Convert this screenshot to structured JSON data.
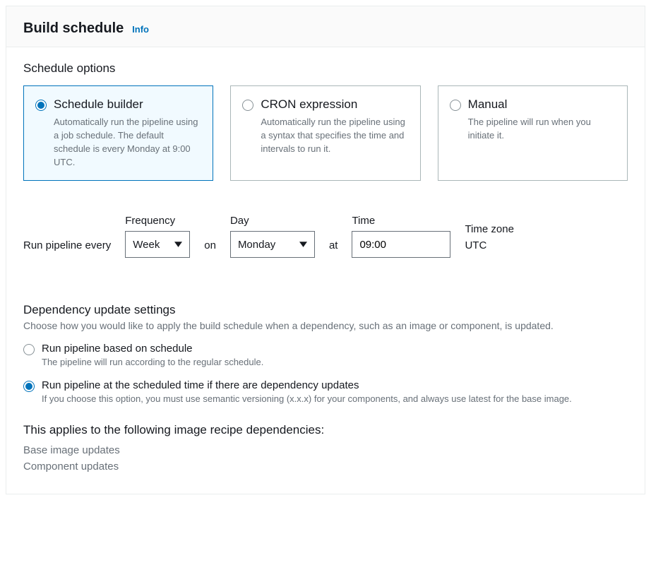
{
  "header": {
    "title": "Build schedule",
    "info_link": "Info"
  },
  "schedule_options": {
    "heading": "Schedule options",
    "cards": [
      {
        "title": "Schedule builder",
        "desc": "Automatically run the pipeline using a job schedule. The default schedule is every Monday at 9:00 UTC.",
        "selected": true
      },
      {
        "title": "CRON expression",
        "desc": "Automatically run the pipeline using a syntax that specifies the time and intervals to run it.",
        "selected": false
      },
      {
        "title": "Manual",
        "desc": "The pipeline will run when you initiate it.",
        "selected": false
      }
    ]
  },
  "schedule_builder": {
    "run_prefix": "Run pipeline every",
    "frequency_label": "Frequency",
    "frequency_value": "Week",
    "on_text": "on",
    "day_label": "Day",
    "day_value": "Monday",
    "at_text": "at",
    "time_label": "Time",
    "time_value": "09:00",
    "timezone_label": "Time zone",
    "timezone_value": "UTC"
  },
  "dependency": {
    "heading": "Dependency update settings",
    "desc": "Choose how you would like to apply the build schedule when a dependency, such as an image or component, is updated.",
    "options": [
      {
        "label": "Run pipeline based on schedule",
        "desc": "The pipeline will run according to the regular schedule.",
        "selected": false
      },
      {
        "label": "Run pipeline at the scheduled time if there are dependency updates",
        "desc": "If you choose this option, you must use semantic versioning (x.x.x) for your components, and always use latest for the base image.",
        "selected": true
      }
    ],
    "applies_heading": "This applies to the following image recipe dependencies:",
    "applies_items": [
      "Base image updates",
      "Component updates"
    ]
  }
}
